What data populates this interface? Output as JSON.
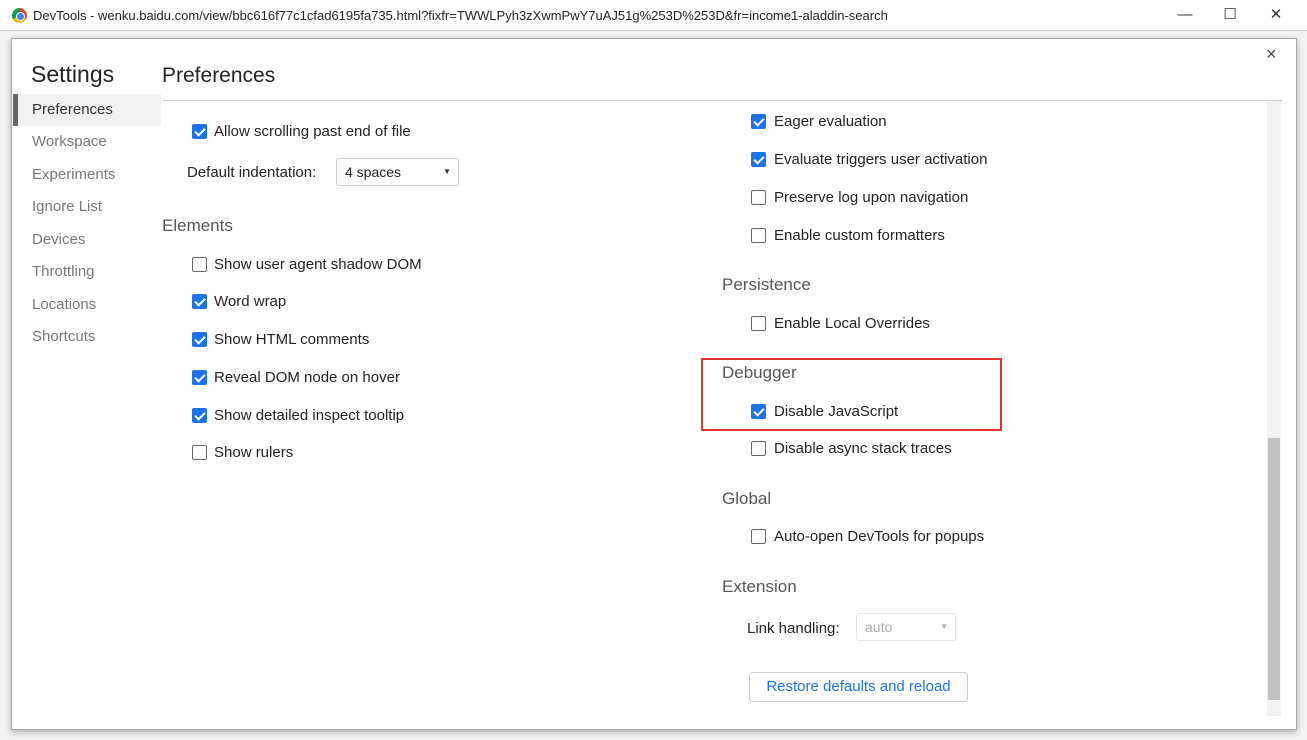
{
  "window": {
    "title": "DevTools - wenku.baidu.com/view/bbc616f77c1cfad6195fa735.html?fixfr=TWWLPyh3zXwmPwY7uAJ51g%253D%253D&fr=income1-aladdin-search",
    "minimize": "—",
    "maximize": "☐",
    "close": "✕"
  },
  "dialog": {
    "close": "×",
    "settings_title": "Settings",
    "page_title": "Preferences"
  },
  "sidebar": {
    "items": [
      {
        "label": "Preferences",
        "selected": true
      },
      {
        "label": "Workspace"
      },
      {
        "label": "Experiments"
      },
      {
        "label": "Ignore List"
      },
      {
        "label": "Devices"
      },
      {
        "label": "Throttling"
      },
      {
        "label": "Locations"
      },
      {
        "label": "Shortcuts"
      }
    ]
  },
  "left": {
    "allow_scrolling": {
      "label": "Allow scrolling past end of file",
      "checked": true
    },
    "indent_label": "Default indentation:",
    "indent_value": "4 spaces",
    "elements_heading": "Elements",
    "elements": [
      {
        "label": "Show user agent shadow DOM",
        "checked": false
      },
      {
        "label": "Word wrap",
        "checked": true
      },
      {
        "label": "Show HTML comments",
        "checked": true
      },
      {
        "label": "Reveal DOM node on hover",
        "checked": true
      },
      {
        "label": "Show detailed inspect tooltip",
        "checked": true
      },
      {
        "label": "Show rulers",
        "checked": false
      }
    ]
  },
  "right": {
    "console": [
      {
        "label": "Eager evaluation",
        "checked": true
      },
      {
        "label": "Evaluate triggers user activation",
        "checked": true
      },
      {
        "label": "Preserve log upon navigation",
        "checked": false
      },
      {
        "label": "Enable custom formatters",
        "checked": false
      }
    ],
    "persistence_heading": "Persistence",
    "persistence": [
      {
        "label": "Enable Local Overrides",
        "checked": false
      }
    ],
    "debugger_heading": "Debugger",
    "debugger": [
      {
        "label": "Disable JavaScript",
        "checked": true
      },
      {
        "label": "Disable async stack traces",
        "checked": false
      }
    ],
    "global_heading": "Global",
    "global": [
      {
        "label": "Auto-open DevTools for popups",
        "checked": false
      }
    ],
    "extension_heading": "Extension",
    "link_handling_label": "Link handling:",
    "link_handling_value": "auto",
    "restore_button": "Restore defaults and reload"
  },
  "highlight_color": "#e03434"
}
